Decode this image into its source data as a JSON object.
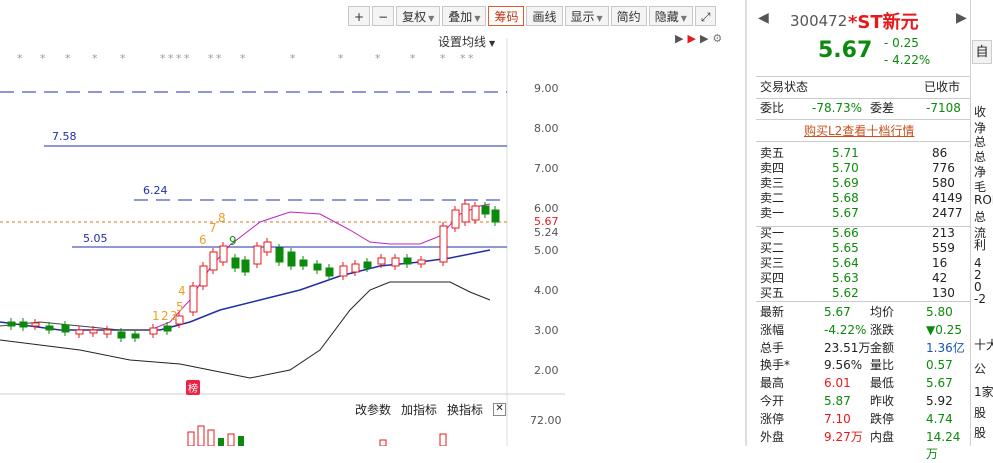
{
  "toolbar": {
    "items": [
      {
        "label": "+",
        "dropdown": false
      },
      {
        "label": "−",
        "dropdown": false
      },
      {
        "label": "复权",
        "dropdown": true
      },
      {
        "label": "叠加",
        "dropdown": true
      },
      {
        "label": "筹码",
        "dropdown": false,
        "active": true
      },
      {
        "label": "画线",
        "dropdown": false
      },
      {
        "label": "显示",
        "dropdown": true
      },
      {
        "label": "简约",
        "dropdown": false
      },
      {
        "label": "隐藏",
        "dropdown": true
      }
    ],
    "ma_setting": "设置均线"
  },
  "chart": {
    "y_axis": [
      "9.00",
      "8.00",
      "7.00",
      "6.00",
      "5.24",
      "5.00",
      "4.00",
      "3.00",
      "2.00"
    ],
    "last_price_tag": "5.67",
    "level_labels": [
      "7.58",
      "6.24",
      "5.05"
    ],
    "wave_labels": [
      "1",
      "2",
      "3",
      "4",
      "5",
      "6",
      "7",
      "8",
      "9"
    ],
    "star_marks": [
      "*",
      "*",
      "*",
      "*",
      "*",
      "*",
      "*",
      "*",
      "*",
      "*",
      "*",
      "*",
      "*",
      "*",
      "*",
      "*",
      "*",
      "*",
      "*"
    ],
    "badge": "榜",
    "volume_axis": "72.00",
    "volume_tools": [
      "改参数",
      "加指标",
      "换指标"
    ]
  },
  "quote": {
    "code": "300472",
    "name": "*ST新元",
    "price": "5.67",
    "change": "- 0.25",
    "change_pct": "- 4.22%",
    "side_button": "自",
    "status_label": "交易状态",
    "status_value": "已收市",
    "weibi_label": "委比",
    "weibi_value": "-78.73%",
    "weicha_label": "委差",
    "weicha_value": "-7108",
    "l2_link": "购买L2查看十档行情",
    "asks": [
      {
        "label": "卖五",
        "price": "5.71",
        "vol": "86"
      },
      {
        "label": "卖四",
        "price": "5.70",
        "vol": "776"
      },
      {
        "label": "卖三",
        "price": "5.69",
        "vol": "580"
      },
      {
        "label": "卖二",
        "price": "5.68",
        "vol": "4149"
      },
      {
        "label": "卖一",
        "price": "5.67",
        "vol": "2477"
      }
    ],
    "bids": [
      {
        "label": "买一",
        "price": "5.66",
        "vol": "213"
      },
      {
        "label": "买二",
        "price": "5.65",
        "vol": "559"
      },
      {
        "label": "买三",
        "price": "5.64",
        "vol": "16"
      },
      {
        "label": "买四",
        "price": "5.63",
        "vol": "42"
      },
      {
        "label": "买五",
        "price": "5.62",
        "vol": "130"
      }
    ],
    "stats": [
      {
        "l1": "最新",
        "v1": "5.67",
        "c1": "green",
        "l2": "均价",
        "v2": "5.80",
        "c2": "green"
      },
      {
        "l1": "涨幅",
        "v1": "-4.22%",
        "c1": "green",
        "l2": "涨跌",
        "v2": "▼0.25",
        "c2": "green"
      },
      {
        "l1": "总手",
        "v1": "23.51万",
        "c1": "",
        "l2": "金额",
        "v2": "1.36亿",
        "c2": "blue"
      },
      {
        "l1": "换手*",
        "v1": "9.56%",
        "c1": "",
        "l2": "量比",
        "v2": "0.57",
        "c2": "green"
      },
      {
        "l1": "最高",
        "v1": "6.01",
        "c1": "red",
        "l2": "最低",
        "v2": "5.67",
        "c2": "green"
      },
      {
        "l1": "今开",
        "v1": "5.87",
        "c1": "green",
        "l2": "昨收",
        "v2": "5.92",
        "c2": ""
      },
      {
        "l1": "涨停",
        "v1": "7.10",
        "c1": "red",
        "l2": "跌停",
        "v2": "4.74",
        "c2": "green"
      },
      {
        "l1": "外盘",
        "v1": "9.27万",
        "c1": "red",
        "l2": "内盘",
        "v2": "14.24万",
        "c2": "green"
      }
    ]
  },
  "side": {
    "items": [
      "收",
      "净",
      "总",
      "总",
      "净",
      "毛",
      "ROE",
      "总",
      "流",
      "利",
      "4",
      "2",
      "0",
      "-2",
      "十大",
      "公",
      "1家",
      "股",
      "股"
    ]
  },
  "colors": {
    "up": "#e8191b",
    "down": "#0b8a0b",
    "accent": "#e05a2a",
    "level": "#1f2fa8"
  }
}
